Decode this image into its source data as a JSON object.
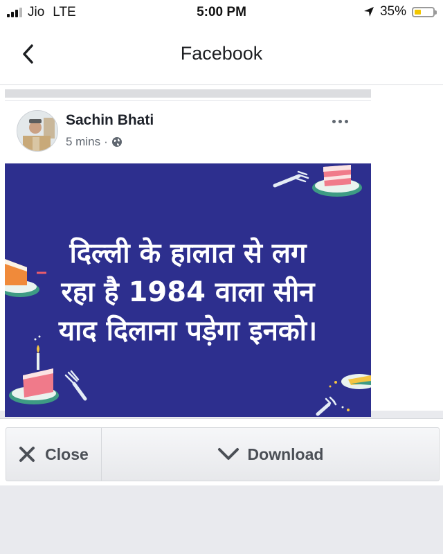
{
  "status_bar": {
    "carrier": "Jio",
    "network": "LTE",
    "time": "5:00 PM",
    "battery_percent": "35%",
    "battery_level": 0.35,
    "location_icon": "location-arrow-icon"
  },
  "nav": {
    "title": "Facebook",
    "back_icon": "chevron-left-icon"
  },
  "post": {
    "author": "Sachin Bhati",
    "time": "5 mins",
    "separator": "·",
    "privacy_icon": "globe-icon",
    "more_icon": "ellipsis-icon",
    "image_text": {
      "line1": "दिल्ली के हालात से लग",
      "line2": "रहा है  1984 वाला सीन",
      "line3": "याद दिलाना पड़ेगा इनको।"
    },
    "image_bg_color": "#2d2f8e"
  },
  "actions": {
    "close_label": "Close",
    "download_label": "Download"
  }
}
